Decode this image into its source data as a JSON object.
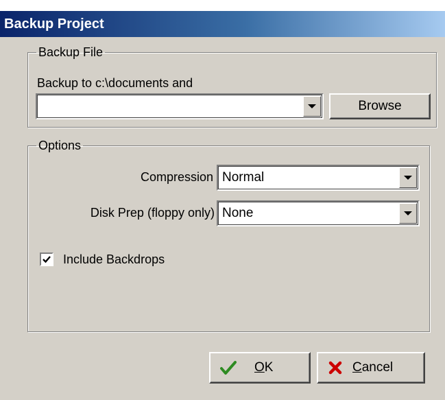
{
  "window": {
    "title": "Backup Project"
  },
  "backup_file": {
    "legend": "Backup File",
    "prompt": "Backup to c:\\documents and",
    "path_value": "",
    "browse_label": "Browse"
  },
  "options": {
    "legend": "Options",
    "compression_label": "Compression",
    "compression_value": "Normal",
    "disk_prep_label": "Disk Prep (floppy only)",
    "disk_prep_value": "None",
    "include_backdrops_label": "Include Backdrops",
    "include_backdrops_checked": true
  },
  "buttons": {
    "ok_label": "OK",
    "ok_mnemonic": "O",
    "ok_rest": "K",
    "cancel_label": "Cancel",
    "cancel_mnemonic": "C",
    "cancel_rest": "ancel"
  },
  "colors": {
    "title_start": "#0a246a",
    "title_end": "#a6caf0",
    "face": "#d4d0c8",
    "ok_check": "#2e8b22",
    "cancel_x": "#cc0000"
  }
}
